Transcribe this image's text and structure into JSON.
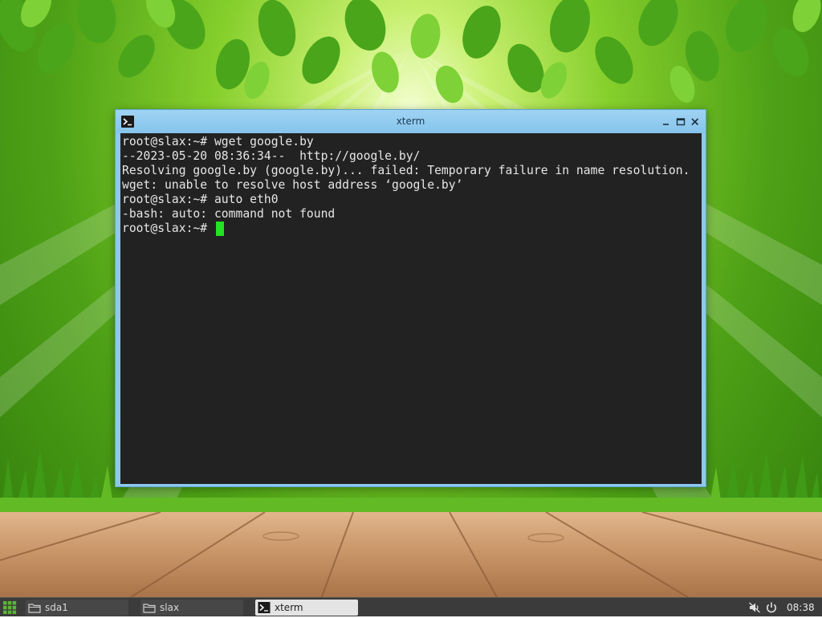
{
  "window": {
    "title": "xterm",
    "icon": "terminal-icon",
    "controls": [
      "minimize-icon",
      "maximize-icon",
      "close-icon"
    ]
  },
  "terminal": {
    "lines": [
      "root@slax:~# wget google.by",
      "--2023-05-20 08:36:34--  http://google.by/",
      "Resolving google.by (google.by)... failed: Temporary failure in name resolution.",
      "wget: unable to resolve host address ‘google.by’",
      "root@slax:~# auto eth0",
      "-bash: auto: command not found",
      "root@slax:~# "
    ],
    "cursor_color": "#22e422",
    "background": "#222222",
    "foreground": "#e6e6e6"
  },
  "taskbar": {
    "start_icon": "app-grid-icon",
    "tasks": [
      {
        "label": "sda1",
        "icon": "folder-icon",
        "active": false
      },
      {
        "label": "slax",
        "icon": "folder-icon",
        "active": false
      },
      {
        "label": "xterm",
        "icon": "terminal-icon",
        "active": true
      }
    ],
    "tray": {
      "volume_icon": "volume-muted-icon",
      "power_icon": "power-icon"
    },
    "clock": "08:38"
  },
  "colors": {
    "titlebar": "#8ec8ee",
    "taskbar": "#3b3b3b",
    "start_green": "#5db33a"
  }
}
